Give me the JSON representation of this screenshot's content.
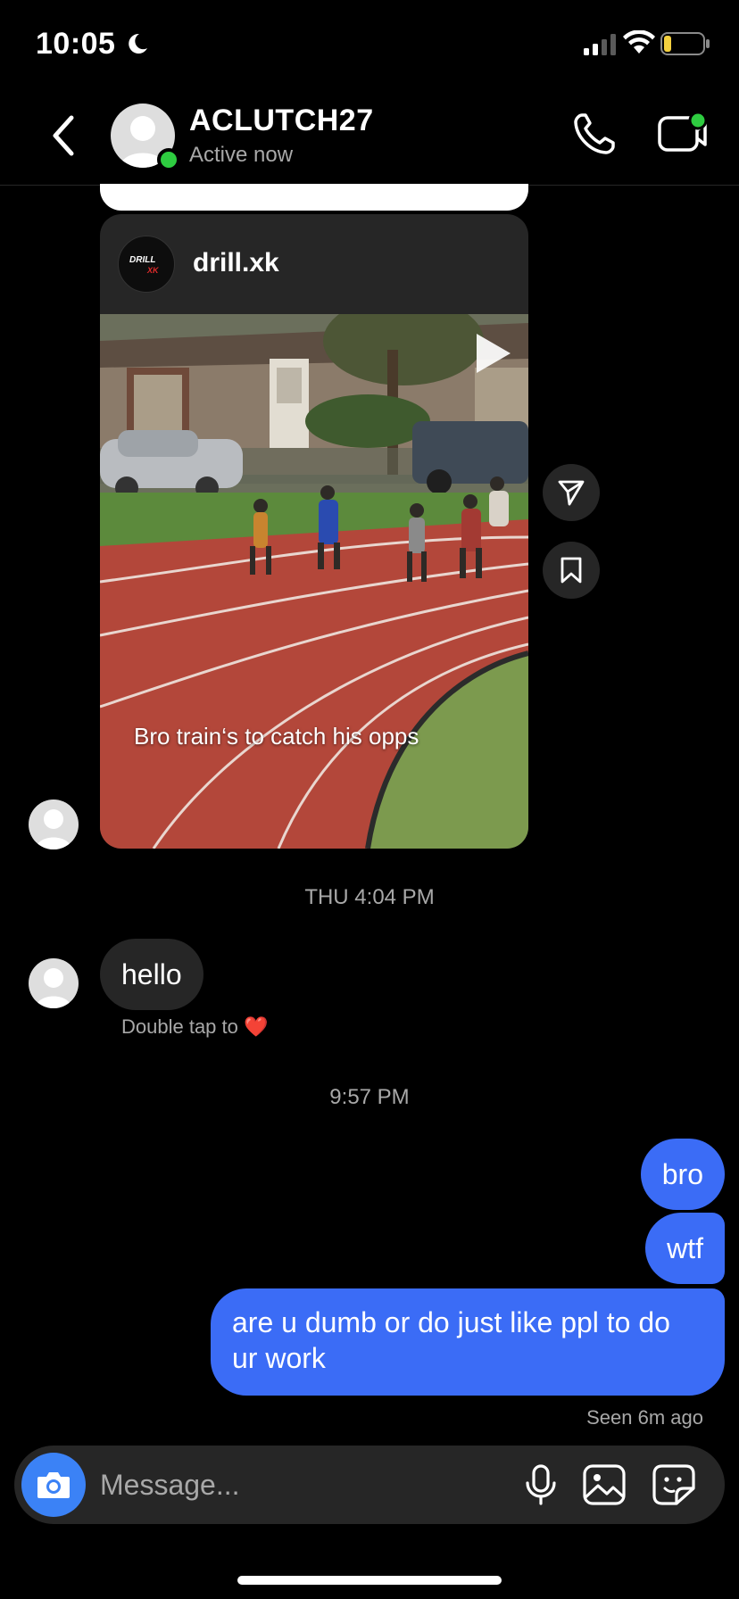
{
  "status_bar": {
    "time": "10:05"
  },
  "header": {
    "contact_name": "ACLUTCH27",
    "contact_status": "Active now"
  },
  "shared_post": {
    "username": "drill.xk",
    "logo_text_top": "DRILL",
    "logo_text_bottom": "XK",
    "caption": "Bro train‘s to catch his opps"
  },
  "messages": {
    "timestamp_1": "THU 4:04 PM",
    "incoming_text": "hello",
    "double_tap_hint": "Double tap to",
    "heart_glyph": "❤️",
    "timestamp_2": "9:57 PM",
    "outgoing": [
      "bro",
      "wtf",
      "are u dumb or do just like ppl to do ur work"
    ],
    "seen_status": "Seen 6m ago"
  },
  "composer": {
    "placeholder": "Message..."
  },
  "colors": {
    "outgoing_bubble": "#3b6cf6",
    "incoming_bubble": "#262626",
    "online_dot": "#2ecc40",
    "camera_button": "#3b82f6",
    "battery_fill": "#f4d03f"
  },
  "icons": {
    "status": [
      "moon-icon",
      "signal-icon",
      "wifi-icon",
      "battery-icon"
    ],
    "header": [
      "back-chevron-icon",
      "phone-icon",
      "video-call-icon"
    ],
    "post": [
      "play-icon",
      "share-icon",
      "bookmark-icon"
    ],
    "composer": [
      "camera-icon",
      "microphone-icon",
      "gallery-icon",
      "sticker-icon"
    ]
  }
}
